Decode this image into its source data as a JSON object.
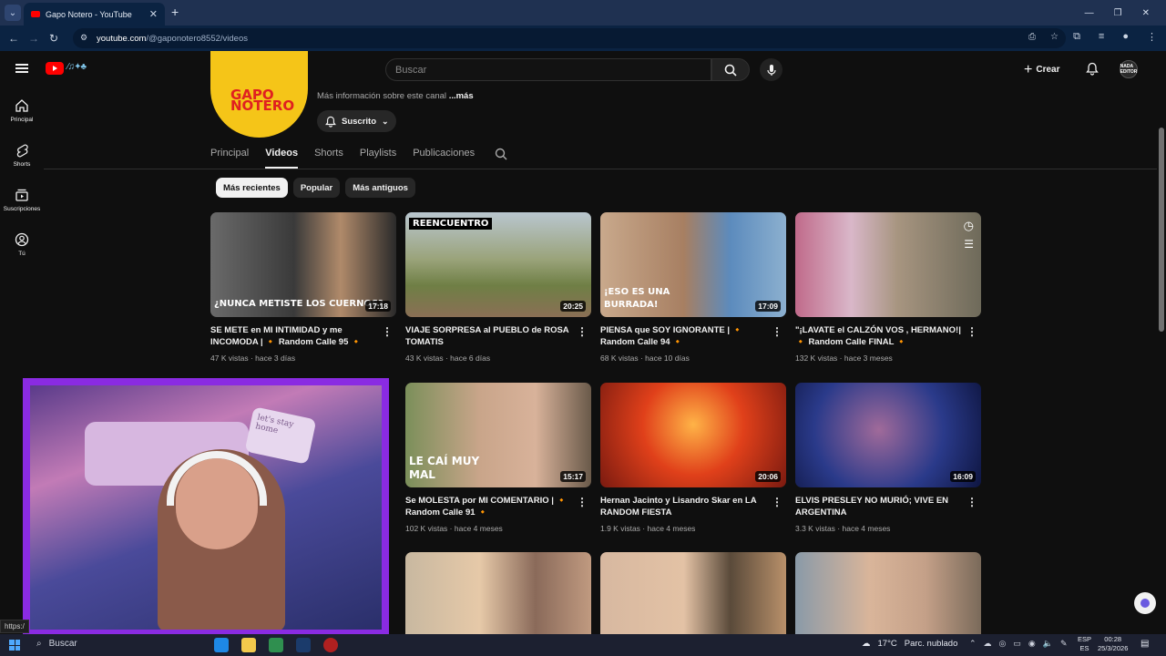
{
  "browser": {
    "tab_title": "Gapo Notero - YouTube",
    "url_host": "youtube.com",
    "url_path": "/@gaponotero8552/videos"
  },
  "header": {
    "search_placeholder": "Buscar",
    "create_label": "Crear",
    "avatar_text": "NADA EDITOR"
  },
  "sidenav": [
    {
      "label": "Principal",
      "icon": "home-icon"
    },
    {
      "label": "Shorts",
      "icon": "shorts-icon"
    },
    {
      "label": "Suscripciones",
      "icon": "subscriptions-icon"
    },
    {
      "label": "Tú",
      "icon": "you-icon"
    }
  ],
  "channel": {
    "avatar_text": "GAPO NOTERO",
    "about_text": "Más información sobre este canal",
    "about_more": "...más",
    "subscribed_label": "Suscrito"
  },
  "tabs": [
    "Principal",
    "Videos",
    "Shorts",
    "Playlists",
    "Publicaciones"
  ],
  "active_tab": "Videos",
  "chips": [
    "Más recientes",
    "Popular",
    "Más antiguos"
  ],
  "videos": [
    {
      "title": "SE METE en MI INTIMIDAD y me INCOMODA | 🔸 Random Calle 95 🔸",
      "views": "47 K vistas",
      "age": "hace 3 días",
      "duration": "17:18",
      "overlay": "¿NUNCA METISTE LOS CUERNOS?"
    },
    {
      "title": "VIAJE SORPRESA al PUEBLO de ROSA TOMATIS",
      "views": "43 K vistas",
      "age": "hace 6 días",
      "duration": "20:25",
      "overlay": "REENCUENTRO"
    },
    {
      "title": "PIENSA que SOY IGNORANTE | 🔸 Random Calle 94 🔸",
      "views": "68 K vistas",
      "age": "hace 10 días",
      "duration": "17:09",
      "overlay": "¡ESO ES UNA BURRADA!"
    },
    {
      "title": "\"¡LAVATE el CALZÓN VOS , HERMANO!| 🔸 Random Calle FINAL 🔸",
      "views": "132 K vistas",
      "age": "hace 3 meses",
      "duration": "",
      "overlay": ""
    },
    {
      "title": "Se MOLESTA por MI COMENTARIO | 🔸 Random Calle 91 🔸",
      "views": "102 K vistas",
      "age": "hace 4 meses",
      "duration": "15:17",
      "overlay": "LE CAÍ MUY MAL"
    },
    {
      "title": "Hernan Jacinto y Lisandro Skar en LA RANDOM FIESTA",
      "views": "1.9 K vistas",
      "age": "hace 4 meses",
      "duration": "20:06",
      "overlay": ""
    },
    {
      "title": "ELVIS PRESLEY NO MURIÓ; VIVE EN ARGENTINA",
      "views": "3.3 K vistas",
      "age": "hace 4 meses",
      "duration": "16:09",
      "overlay": ""
    }
  ],
  "webcam": {
    "pillow_text": "let's stay home"
  },
  "status_url": "https:/",
  "taskbar": {
    "search_label": "Buscar",
    "weather": "17°C",
    "weather_desc": "Parc. nublado",
    "lang1": "ESP",
    "lang2": "ES",
    "time": "00:28",
    "date": "25/3/2026"
  },
  "colors": {
    "yt_red": "#ff0000",
    "bg": "#0f0f0f",
    "webcam_border": "#8a2be2",
    "chrome_tab": "#1f3151"
  }
}
